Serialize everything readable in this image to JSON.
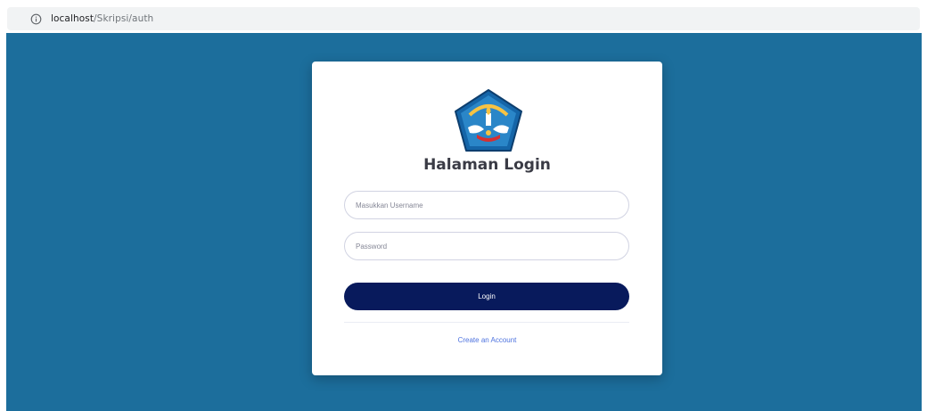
{
  "browser": {
    "url_host": "localhost",
    "url_path": "/Skripsi/auth"
  },
  "login_card": {
    "logo": "tut-wuri-handayani-logo",
    "title": "Halaman Login",
    "username_placeholder": "Masukkan Username",
    "password_placeholder": "Password",
    "login_label": "Login",
    "create_account_label": "Create an Account"
  },
  "colors": {
    "page_background": "#1c6e9c",
    "button": "#081a5c",
    "link": "#4e73df",
    "card": "#ffffff"
  }
}
